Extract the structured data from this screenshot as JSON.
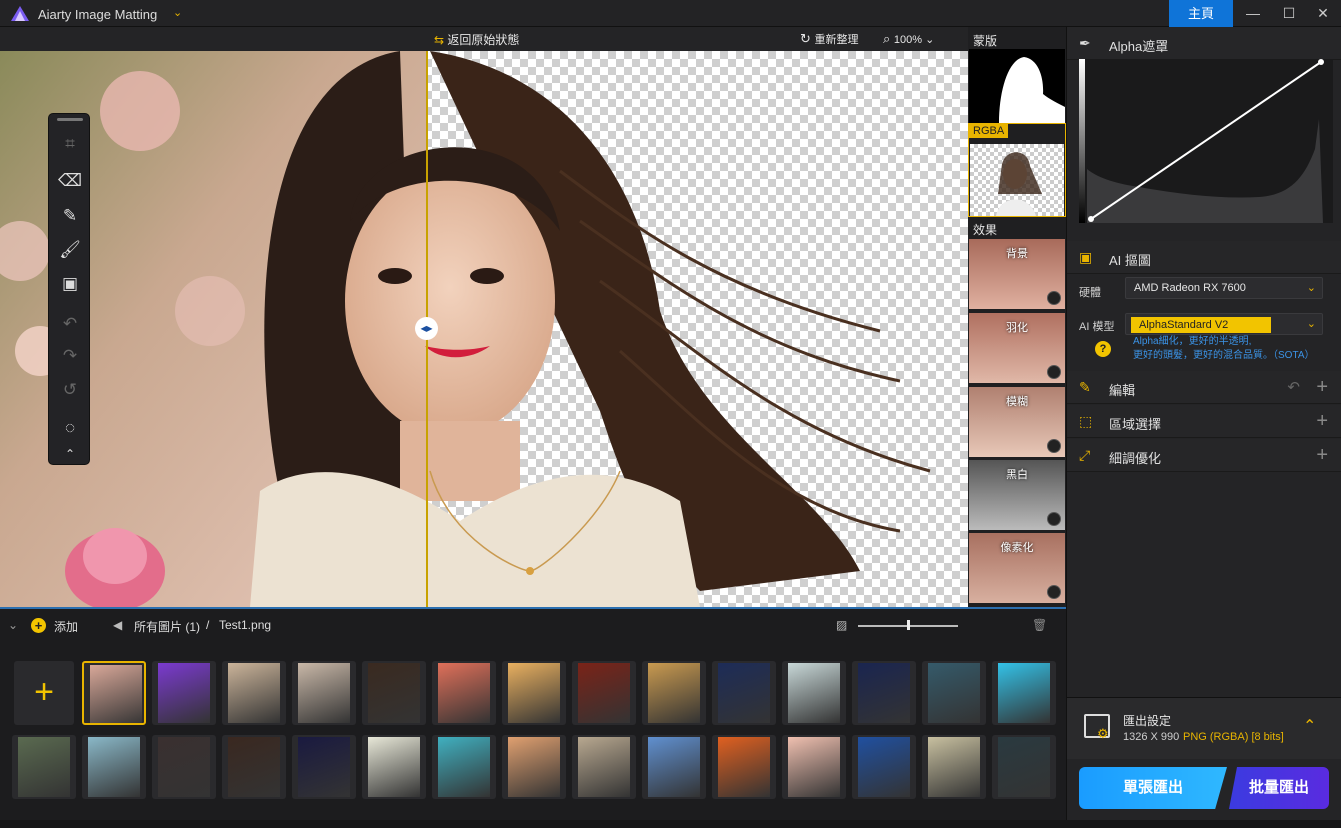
{
  "app": {
    "title": "Aiarty Image Matting",
    "home_label": "主頁"
  },
  "canvas_toolbar": {
    "restore_label": "返回原始狀態",
    "reorganize_label": "重新整理",
    "zoom_level": "100%"
  },
  "preview": {
    "mask_label": "蒙版",
    "rgba_label": "RGBA",
    "effects_label": "效果",
    "effects": [
      {
        "label": "背景"
      },
      {
        "label": "羽化"
      },
      {
        "label": "模糊"
      },
      {
        "label": "黑白"
      },
      {
        "label": "像素化"
      }
    ]
  },
  "strip": {
    "add_label": "添加",
    "breadcrumb_all": "所有圖片 (1)",
    "breadcrumb_sep": "/",
    "breadcrumb_file": "Test1.png",
    "thumb_slider_fraction": 0.49
  },
  "right_panel": {
    "alpha_title": "Alpha遮罩",
    "ai_title": "AI 摳圖",
    "hardware_label": "硬體",
    "hardware_value": "AMD Radeon RX 7600",
    "model_label": "AI 模型",
    "model_value": "AlphaStandard  V2",
    "model_desc_1": "Alpha細化，更好的半透明,",
    "model_desc_2": "更好的頭髮，更好的混合品質。（SOTA）",
    "edit_title": "編輯",
    "region_title": "區域選擇",
    "refine_title": "細調優化",
    "export_title": "匯出設定",
    "export_size": "1326 X 990",
    "export_format": "PNG (RGBA) [8 bits]",
    "single_export": "單張匯出",
    "batch_export": "批量匯出"
  }
}
